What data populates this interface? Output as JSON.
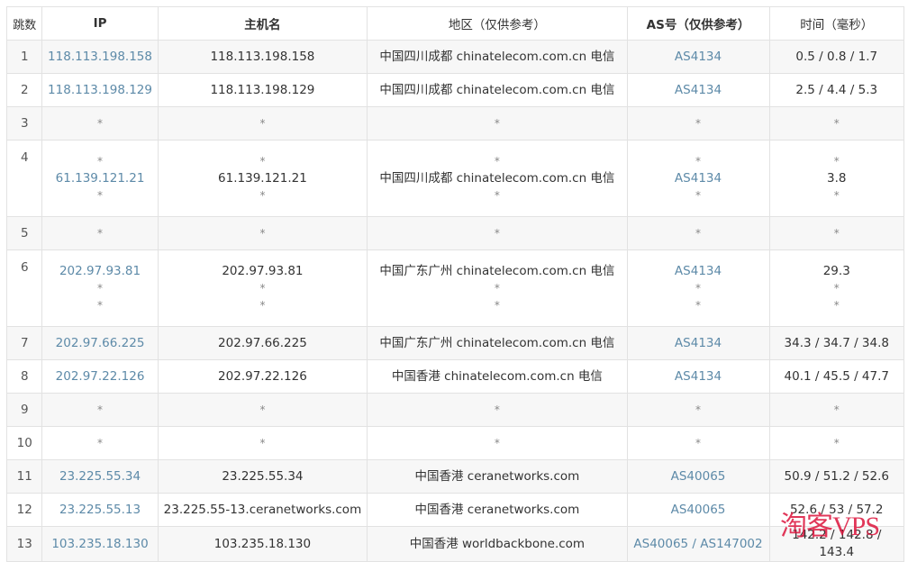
{
  "table": {
    "headers": {
      "hop": "跳数",
      "ip": "IP",
      "hostname": "主机名",
      "region": "地区（仅供参考）",
      "as": "AS号（仅供参考）",
      "time": "时间（毫秒）"
    },
    "rows": [
      {
        "hop": "1",
        "ip": [
          "118.113.198.158"
        ],
        "hostname": [
          "118.113.198.158"
        ],
        "region": [
          "中国四川成都 chinatelecom.com.cn 电信"
        ],
        "as": [
          "AS4134"
        ],
        "time": [
          "0.5 / 0.8 / 1.7"
        ]
      },
      {
        "hop": "2",
        "ip": [
          "118.113.198.129"
        ],
        "hostname": [
          "118.113.198.129"
        ],
        "region": [
          "中国四川成都 chinatelecom.com.cn 电信"
        ],
        "as": [
          "AS4134"
        ],
        "time": [
          "2.5 / 4.4 / 5.3"
        ]
      },
      {
        "hop": "3",
        "ip": [
          "*"
        ],
        "hostname": [
          "*"
        ],
        "region": [
          "*"
        ],
        "as": [
          "*"
        ],
        "time": [
          "*"
        ]
      },
      {
        "hop": "4",
        "ip": [
          "*",
          "61.139.121.21",
          "*"
        ],
        "hostname": [
          "*",
          "61.139.121.21",
          "*"
        ],
        "region": [
          "*",
          "中国四川成都 chinatelecom.com.cn 电信",
          "*"
        ],
        "as": [
          "*",
          "AS4134",
          "*"
        ],
        "time": [
          "*",
          "3.8",
          "*"
        ]
      },
      {
        "hop": "5",
        "ip": [
          "*"
        ],
        "hostname": [
          "*"
        ],
        "region": [
          "*"
        ],
        "as": [
          "*"
        ],
        "time": [
          "*"
        ]
      },
      {
        "hop": "6",
        "ip": [
          "202.97.93.81",
          "*",
          "*"
        ],
        "hostname": [
          "202.97.93.81",
          "*",
          "*"
        ],
        "region": [
          "中国广东广州 chinatelecom.com.cn 电信",
          "*",
          "*"
        ],
        "as": [
          "AS4134",
          "*",
          "*"
        ],
        "time": [
          "29.3",
          "*",
          "*"
        ]
      },
      {
        "hop": "7",
        "ip": [
          "202.97.66.225"
        ],
        "hostname": [
          "202.97.66.225"
        ],
        "region": [
          "中国广东广州 chinatelecom.com.cn 电信"
        ],
        "as": [
          "AS4134"
        ],
        "time": [
          "34.3 / 34.7 / 34.8"
        ]
      },
      {
        "hop": "8",
        "ip": [
          "202.97.22.126"
        ],
        "hostname": [
          "202.97.22.126"
        ],
        "region": [
          "中国香港 chinatelecom.com.cn 电信"
        ],
        "as": [
          "AS4134"
        ],
        "time": [
          "40.1 / 45.5 / 47.7"
        ]
      },
      {
        "hop": "9",
        "ip": [
          "*"
        ],
        "hostname": [
          "*"
        ],
        "region": [
          "*"
        ],
        "as": [
          "*"
        ],
        "time": [
          "*"
        ]
      },
      {
        "hop": "10",
        "ip": [
          "*"
        ],
        "hostname": [
          "*"
        ],
        "region": [
          "*"
        ],
        "as": [
          "*"
        ],
        "time": [
          "*"
        ]
      },
      {
        "hop": "11",
        "ip": [
          "23.225.55.34"
        ],
        "hostname": [
          "23.225.55.34"
        ],
        "region": [
          "中国香港 ceranetworks.com"
        ],
        "as": [
          "AS40065"
        ],
        "time": [
          "50.9 / 51.2 / 52.6"
        ]
      },
      {
        "hop": "12",
        "ip": [
          "23.225.55.13"
        ],
        "hostname": [
          "23.225.55-13.ceranetworks.com"
        ],
        "region": [
          "中国香港 ceranetworks.com"
        ],
        "as": [
          "AS40065"
        ],
        "time": [
          "52.6 / 53 / 57.2"
        ]
      },
      {
        "hop": "13",
        "ip": [
          "103.235.18.130"
        ],
        "hostname": [
          "103.235.18.130"
        ],
        "region": [
          "中国香港 worldbackbone.com"
        ],
        "as": [
          "AS40065 / AS147002"
        ],
        "time": [
          "142.2 / 142.8 / 143.4"
        ]
      }
    ]
  },
  "watermark": "淘客VPS"
}
